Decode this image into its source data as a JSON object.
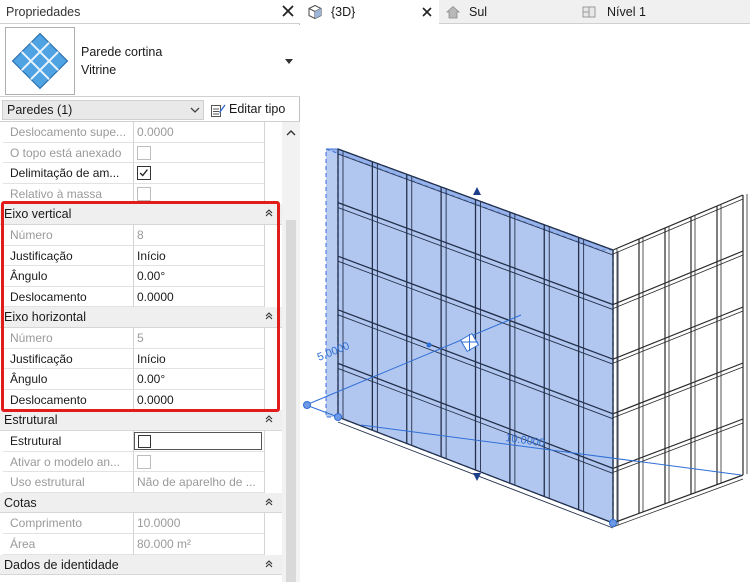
{
  "properties": {
    "title": "Propriedades",
    "type_name": "Parede cortina",
    "type_subname": "Vitrine",
    "filter_label": "Paredes (1)",
    "edit_type_label": "Editar tipo",
    "rows": [
      {
        "kind": "prop",
        "name": "Deslocamento supe...",
        "value": "0.0000",
        "gray": true
      },
      {
        "kind": "prop",
        "name": "O topo está anexado",
        "value": "",
        "control": "checkbox",
        "checked": false,
        "gray": true
      },
      {
        "kind": "prop",
        "name": "Delimitação de am...",
        "value": "",
        "control": "checkbox",
        "checked": true,
        "gray": false
      },
      {
        "kind": "prop",
        "name": "Relativo à massa",
        "value": "",
        "control": "checkbox",
        "checked": false,
        "gray": true
      },
      {
        "kind": "group",
        "name": "Eixo vertical"
      },
      {
        "kind": "prop",
        "name": "Número",
        "value": "8",
        "gray": true
      },
      {
        "kind": "prop",
        "name": "Justificação",
        "value": "Início",
        "gray": false
      },
      {
        "kind": "prop",
        "name": "Ângulo",
        "value": "0.00°",
        "gray": false
      },
      {
        "kind": "prop",
        "name": "Deslocamento",
        "value": "0.0000",
        "gray": false
      },
      {
        "kind": "group",
        "name": "Eixo horizontal"
      },
      {
        "kind": "prop",
        "name": "Número",
        "value": "5",
        "gray": true
      },
      {
        "kind": "prop",
        "name": "Justificação",
        "value": "Início",
        "gray": false
      },
      {
        "kind": "prop",
        "name": "Ângulo",
        "value": "0.00°",
        "gray": false
      },
      {
        "kind": "prop",
        "name": "Deslocamento",
        "value": "0.0000",
        "gray": false
      },
      {
        "kind": "group",
        "name": "Estrutural"
      },
      {
        "kind": "prop",
        "name": "Estrutural",
        "value": "",
        "control": "checkbox-wide",
        "checked": false,
        "gray": false
      },
      {
        "kind": "prop",
        "name": "Ativar o modelo an...",
        "value": "",
        "control": "checkbox",
        "checked": false,
        "gray": true
      },
      {
        "kind": "prop",
        "name": "Uso estrutural",
        "value": "Não de aparelho de ...",
        "gray": true
      },
      {
        "kind": "group",
        "name": "Cotas"
      },
      {
        "kind": "prop",
        "name": "Comprimento",
        "value": "10.0000",
        "gray": true
      },
      {
        "kind": "prop",
        "name": "Área",
        "value": "80.000 m²",
        "gray": true
      },
      {
        "kind": "group",
        "name": "Dados de identidade"
      }
    ]
  },
  "tabs": [
    {
      "label": "{3D}",
      "active": true,
      "icon": "3d-cube-icon"
    },
    {
      "label": "Sul",
      "active": false,
      "icon": "elevation-house-icon"
    },
    {
      "label": "Nível 1",
      "active": false,
      "icon": "floor-plan-icon"
    }
  ],
  "viewport": {
    "dim_vertical": "5.0000",
    "dim_horizontal": "10.0000",
    "grid_columns": 8,
    "grid_rows": 5
  },
  "colors": {
    "selection_fill": "#7ea1e6",
    "selection_edge": "#3a6fd8",
    "highlight_box": "#e21b1b",
    "dimension": "#2f6fd6"
  }
}
